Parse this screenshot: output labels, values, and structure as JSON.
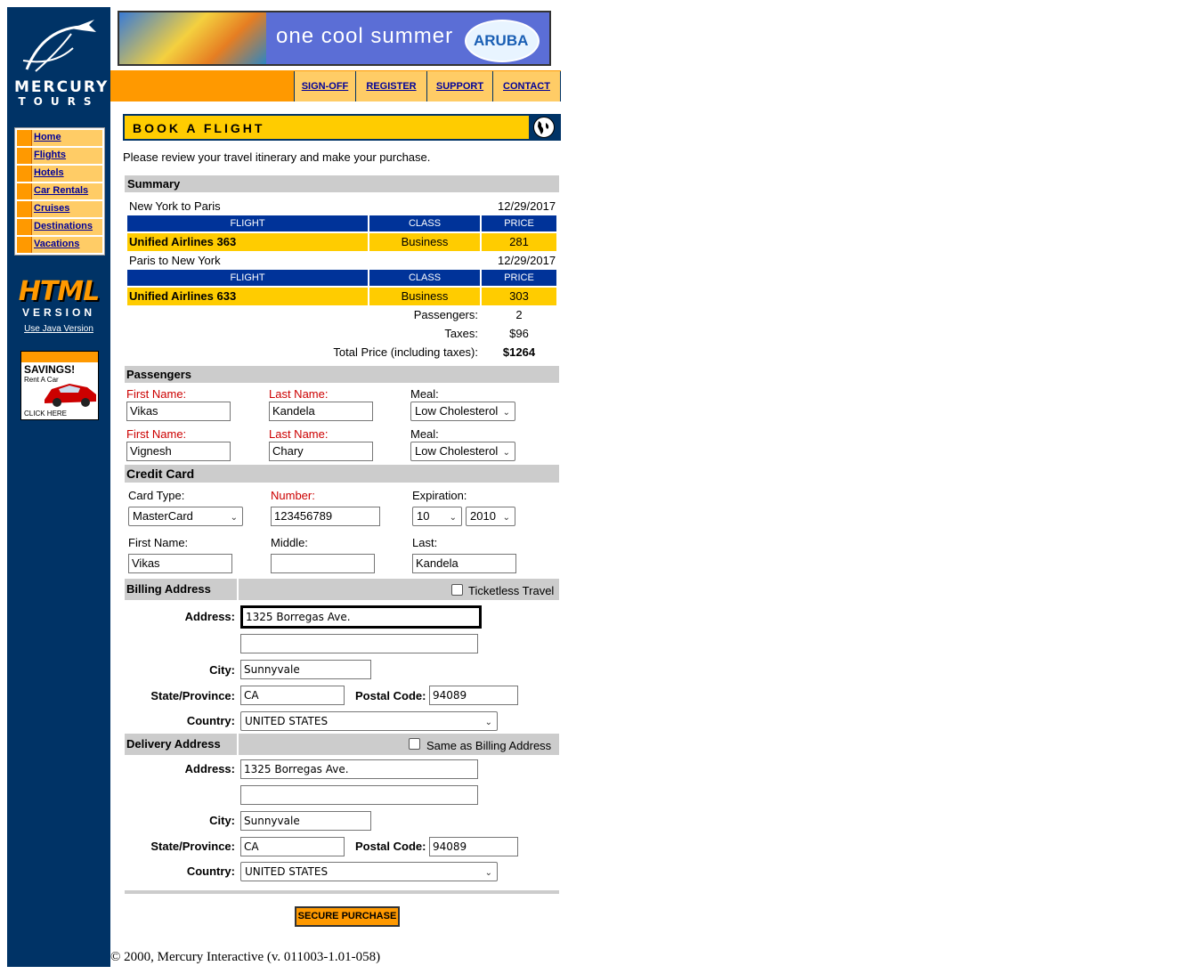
{
  "sidebar": {
    "logo_line1": "MERCURY",
    "logo_line2": "TOURS",
    "nav": [
      "Home",
      "Flights",
      "Hotels",
      "Car Rentals",
      "Cruises",
      "Destinations",
      "Vacations"
    ],
    "html_version_line1": "HTML",
    "html_version_line2": "VERSION",
    "java_link": "Use Java Version",
    "ad_title": "SAVINGS!",
    "ad_sub": "Rent A Car",
    "ad_cta": "CLICK HERE"
  },
  "banner": {
    "text": "one cool summer",
    "brand": "ARUBA"
  },
  "topnav": [
    "SIGN-OFF",
    "REGISTER",
    "SUPPORT",
    "CONTACT"
  ],
  "page": {
    "title": "BOOK A FLIGHT",
    "intro": "Please review your travel itinerary and make your purchase."
  },
  "summary": {
    "heading": "Summary",
    "col_flight": "FLIGHT",
    "col_class": "CLASS",
    "col_price": "PRICE",
    "legs": [
      {
        "route": "New York to Paris",
        "date": "12/29/2017",
        "flight": "Unified Airlines 363",
        "class": "Business",
        "price": "281"
      },
      {
        "route": "Paris to New York",
        "date": "12/29/2017",
        "flight": "Unified Airlines 633",
        "class": "Business",
        "price": "303"
      }
    ],
    "passengers_label": "Passengers:",
    "passengers_value": "2",
    "taxes_label": "Taxes:",
    "taxes_value": "$96",
    "total_label": "Total Price (including taxes):",
    "total_value": "$1264"
  },
  "passengers": {
    "heading": "Passengers",
    "first_label": "First Name:",
    "last_label": "Last Name:",
    "meal_label": "Meal:",
    "list": [
      {
        "first": "Vikas",
        "last": "Kandela",
        "meal": "Low Cholesterol"
      },
      {
        "first": "Vignesh",
        "last": "Chary",
        "meal": "Low Cholesterol"
      }
    ]
  },
  "credit_card": {
    "heading": "Credit Card",
    "type_label": "Card Type:",
    "type_value": "MasterCard",
    "number_label": "Number:",
    "number_value": "123456789",
    "expiration_label": "Expiration:",
    "exp_month": "10",
    "exp_year": "2010",
    "first_label": "First Name:",
    "first_value": "Vikas",
    "middle_label": "Middle:",
    "middle_value": "",
    "last_label": "Last:",
    "last_value": "Kandela"
  },
  "billing": {
    "heading": "Billing Address",
    "checkbox_label": "Ticketless Travel",
    "address_label": "Address:",
    "address1": "1325 Borregas Ave.",
    "address2": "",
    "city_label": "City:",
    "city": "Sunnyvale",
    "state_label": "State/Province:",
    "state": "CA",
    "postal_label": "Postal Code:",
    "postal": "94089",
    "country_label": "Country:",
    "country": "UNITED STATES"
  },
  "delivery": {
    "heading": "Delivery Address",
    "checkbox_label": "Same as Billing Address",
    "address_label": "Address:",
    "address1": "1325 Borregas Ave.",
    "address2": "",
    "city_label": "City:",
    "city": "Sunnyvale",
    "state_label": "State/Province:",
    "state": "CA",
    "postal_label": "Postal Code:",
    "postal": "94089",
    "country_label": "Country:",
    "country": "UNITED STATES"
  },
  "secure_button": "SECURE PURCHASE",
  "footer": "© 2000, Mercury Interactive (v. 011003-1.01-058)",
  "colors": {
    "sidebar": "#003366",
    "orange": "#ff9900",
    "yellow": "#ffcc00",
    "blue_header": "#003399",
    "grey_header": "#cccccc",
    "required_label": "#cc0000"
  }
}
